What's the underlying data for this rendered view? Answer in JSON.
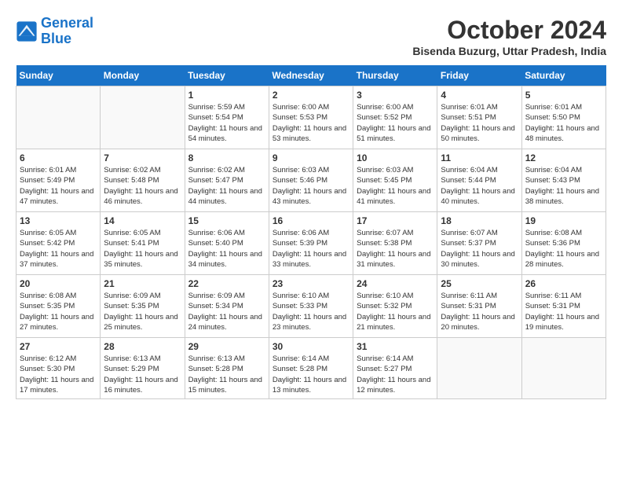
{
  "header": {
    "logo_line1": "General",
    "logo_line2": "Blue",
    "month": "October 2024",
    "location": "Bisenda Buzurg, Uttar Pradesh, India"
  },
  "days_of_week": [
    "Sunday",
    "Monday",
    "Tuesday",
    "Wednesday",
    "Thursday",
    "Friday",
    "Saturday"
  ],
  "weeks": [
    [
      {
        "day": "",
        "info": ""
      },
      {
        "day": "",
        "info": ""
      },
      {
        "day": "1",
        "info": "Sunrise: 5:59 AM\nSunset: 5:54 PM\nDaylight: 11 hours and 54 minutes."
      },
      {
        "day": "2",
        "info": "Sunrise: 6:00 AM\nSunset: 5:53 PM\nDaylight: 11 hours and 53 minutes."
      },
      {
        "day": "3",
        "info": "Sunrise: 6:00 AM\nSunset: 5:52 PM\nDaylight: 11 hours and 51 minutes."
      },
      {
        "day": "4",
        "info": "Sunrise: 6:01 AM\nSunset: 5:51 PM\nDaylight: 11 hours and 50 minutes."
      },
      {
        "day": "5",
        "info": "Sunrise: 6:01 AM\nSunset: 5:50 PM\nDaylight: 11 hours and 48 minutes."
      }
    ],
    [
      {
        "day": "6",
        "info": "Sunrise: 6:01 AM\nSunset: 5:49 PM\nDaylight: 11 hours and 47 minutes."
      },
      {
        "day": "7",
        "info": "Sunrise: 6:02 AM\nSunset: 5:48 PM\nDaylight: 11 hours and 46 minutes."
      },
      {
        "day": "8",
        "info": "Sunrise: 6:02 AM\nSunset: 5:47 PM\nDaylight: 11 hours and 44 minutes."
      },
      {
        "day": "9",
        "info": "Sunrise: 6:03 AM\nSunset: 5:46 PM\nDaylight: 11 hours and 43 minutes."
      },
      {
        "day": "10",
        "info": "Sunrise: 6:03 AM\nSunset: 5:45 PM\nDaylight: 11 hours and 41 minutes."
      },
      {
        "day": "11",
        "info": "Sunrise: 6:04 AM\nSunset: 5:44 PM\nDaylight: 11 hours and 40 minutes."
      },
      {
        "day": "12",
        "info": "Sunrise: 6:04 AM\nSunset: 5:43 PM\nDaylight: 11 hours and 38 minutes."
      }
    ],
    [
      {
        "day": "13",
        "info": "Sunrise: 6:05 AM\nSunset: 5:42 PM\nDaylight: 11 hours and 37 minutes."
      },
      {
        "day": "14",
        "info": "Sunrise: 6:05 AM\nSunset: 5:41 PM\nDaylight: 11 hours and 35 minutes."
      },
      {
        "day": "15",
        "info": "Sunrise: 6:06 AM\nSunset: 5:40 PM\nDaylight: 11 hours and 34 minutes."
      },
      {
        "day": "16",
        "info": "Sunrise: 6:06 AM\nSunset: 5:39 PM\nDaylight: 11 hours and 33 minutes."
      },
      {
        "day": "17",
        "info": "Sunrise: 6:07 AM\nSunset: 5:38 PM\nDaylight: 11 hours and 31 minutes."
      },
      {
        "day": "18",
        "info": "Sunrise: 6:07 AM\nSunset: 5:37 PM\nDaylight: 11 hours and 30 minutes."
      },
      {
        "day": "19",
        "info": "Sunrise: 6:08 AM\nSunset: 5:36 PM\nDaylight: 11 hours and 28 minutes."
      }
    ],
    [
      {
        "day": "20",
        "info": "Sunrise: 6:08 AM\nSunset: 5:35 PM\nDaylight: 11 hours and 27 minutes."
      },
      {
        "day": "21",
        "info": "Sunrise: 6:09 AM\nSunset: 5:35 PM\nDaylight: 11 hours and 25 minutes."
      },
      {
        "day": "22",
        "info": "Sunrise: 6:09 AM\nSunset: 5:34 PM\nDaylight: 11 hours and 24 minutes."
      },
      {
        "day": "23",
        "info": "Sunrise: 6:10 AM\nSunset: 5:33 PM\nDaylight: 11 hours and 23 minutes."
      },
      {
        "day": "24",
        "info": "Sunrise: 6:10 AM\nSunset: 5:32 PM\nDaylight: 11 hours and 21 minutes."
      },
      {
        "day": "25",
        "info": "Sunrise: 6:11 AM\nSunset: 5:31 PM\nDaylight: 11 hours and 20 minutes."
      },
      {
        "day": "26",
        "info": "Sunrise: 6:11 AM\nSunset: 5:31 PM\nDaylight: 11 hours and 19 minutes."
      }
    ],
    [
      {
        "day": "27",
        "info": "Sunrise: 6:12 AM\nSunset: 5:30 PM\nDaylight: 11 hours and 17 minutes."
      },
      {
        "day": "28",
        "info": "Sunrise: 6:13 AM\nSunset: 5:29 PM\nDaylight: 11 hours and 16 minutes."
      },
      {
        "day": "29",
        "info": "Sunrise: 6:13 AM\nSunset: 5:28 PM\nDaylight: 11 hours and 15 minutes."
      },
      {
        "day": "30",
        "info": "Sunrise: 6:14 AM\nSunset: 5:28 PM\nDaylight: 11 hours and 13 minutes."
      },
      {
        "day": "31",
        "info": "Sunrise: 6:14 AM\nSunset: 5:27 PM\nDaylight: 11 hours and 12 minutes."
      },
      {
        "day": "",
        "info": ""
      },
      {
        "day": "",
        "info": ""
      }
    ]
  ]
}
